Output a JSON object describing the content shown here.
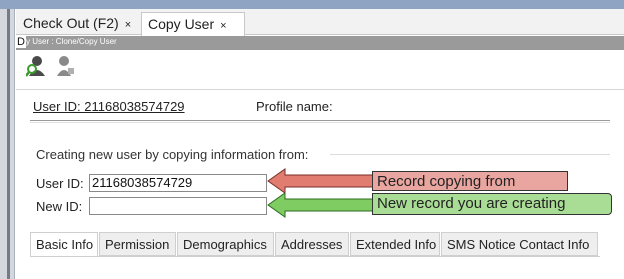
{
  "tabs": [
    {
      "label": "Check Out (F2)",
      "close": "×"
    },
    {
      "label": "Copy User",
      "close": "×"
    }
  ],
  "subheader": {
    "prefix": "D",
    "breadcrumb": "y User : Clone/Copy User"
  },
  "icons": [
    "user-search-icon",
    "user-icon"
  ],
  "user_info": {
    "user_id_label": "User ID: 21168038574729",
    "profile_label": "Profile name:"
  },
  "copy_group": {
    "title": "Creating new user by copying information from:",
    "user_id_label": "User ID:",
    "user_id_value": "21168038574729",
    "new_id_label": "New ID:",
    "new_id_value": ""
  },
  "callouts": {
    "copying_from": "Record copying from",
    "creating": "New record you are creating"
  },
  "colors": {
    "callout_red": "#e9a6a0",
    "callout_green": "#a9dd96",
    "arrow_red": "#e07c70",
    "arrow_green": "#7fcc63"
  },
  "subtabs": [
    "Basic Info",
    "Permission",
    "Demographics",
    "Addresses",
    "Extended Info",
    "SMS Notice Contact Info"
  ]
}
